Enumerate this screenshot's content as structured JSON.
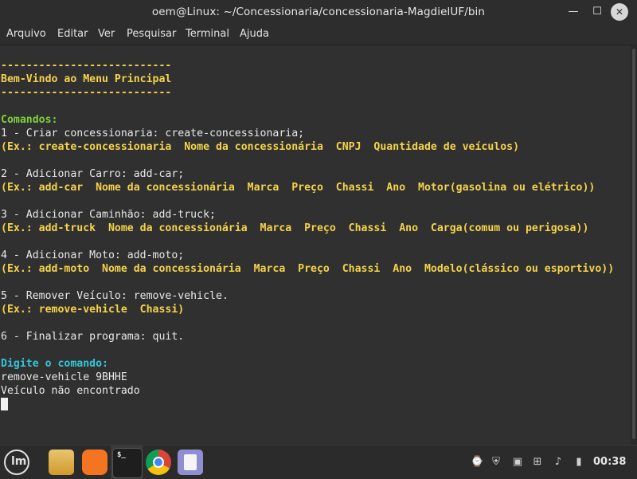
{
  "window": {
    "title": "oem@Linux: ~/Concessionaria/concessionaria-MagdielUF/bin",
    "minimize_label": "—",
    "maximize_label": "☐",
    "close_label": "✕"
  },
  "menubar": [
    "Arquivo",
    "Editar",
    "Ver",
    "Pesquisar",
    "Terminal",
    "Ajuda"
  ],
  "terminal": {
    "lines": [
      {
        "text": "---------------------------",
        "style": "yellow"
      },
      {
        "text": "Bem-Vindo ao Menu Principal",
        "style": "yellow"
      },
      {
        "text": "---------------------------",
        "style": "yellow"
      },
      {
        "text": "",
        "style": "white"
      },
      {
        "text": "Comandos:",
        "style": "green"
      },
      {
        "text": "1 - Criar concessionaria: create-concessionaria;",
        "style": "white"
      },
      {
        "text": "(Ex.: create-concessionaria  Nome da concessionária  CNPJ  Quantidade de veículos)",
        "style": "yellow"
      },
      {
        "text": "",
        "style": "white"
      },
      {
        "text": "2 - Adicionar Carro: add-car;",
        "style": "white"
      },
      {
        "text": "(Ex.: add-car  Nome da concessionária  Marca  Preço  Chassi  Ano  Motor(gasolina ou elétrico))",
        "style": "yellow"
      },
      {
        "text": "",
        "style": "white"
      },
      {
        "text": "3 - Adicionar Caminhão: add-truck;",
        "style": "white"
      },
      {
        "text": "(Ex.: add-truck  Nome da concessionária  Marca  Preço  Chassi  Ano  Carga(comum ou perigosa))",
        "style": "yellow"
      },
      {
        "text": "",
        "style": "white"
      },
      {
        "text": "4 - Adicionar Moto: add-moto;",
        "style": "white"
      },
      {
        "text": "(Ex.: add-moto  Nome da concessionária  Marca  Preço  Chassi  Ano  Modelo(clássico ou esportivo))",
        "style": "yellow"
      },
      {
        "text": "",
        "style": "white"
      },
      {
        "text": "5 - Remover Veículo: remove-vehicle.",
        "style": "white"
      },
      {
        "text": "(Ex.: remove-vehicle  Chassi)",
        "style": "yellow"
      },
      {
        "text": "",
        "style": "white"
      },
      {
        "text": "6 - Finalizar programa: quit.",
        "style": "white"
      },
      {
        "text": "",
        "style": "white"
      },
      {
        "text": "Digite o comando:",
        "style": "cyan"
      },
      {
        "text": "remove-vehicle 9BHHE",
        "style": "white"
      },
      {
        "text": "Veículo não encontrado",
        "style": "white"
      }
    ]
  },
  "taskbar": {
    "menu_logo": "lm",
    "apps": [
      "files-icon",
      "firefox-icon",
      "terminal-icon",
      "chrome-icon",
      "text-editor-icon"
    ],
    "terminal_prompt_glyph": "$_",
    "clock": "00:38"
  },
  "colors": {
    "prompt_yellow": "#f5d34a",
    "prompt_green": "#7fd13b",
    "prompt_cyan": "#33c7d9"
  }
}
